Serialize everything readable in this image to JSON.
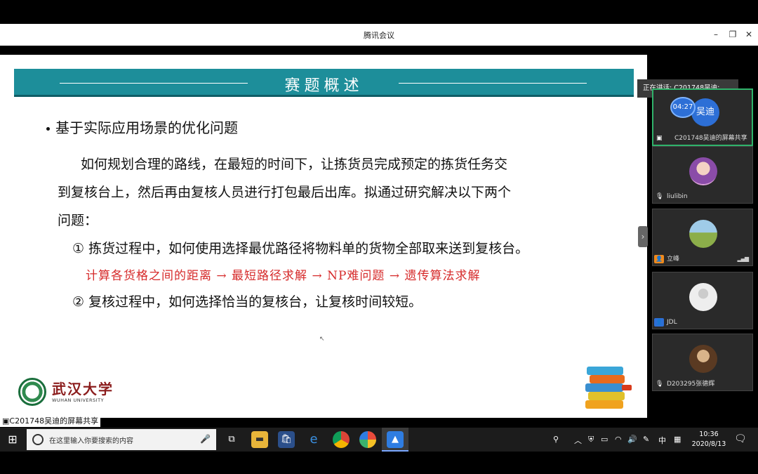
{
  "window": {
    "title": "腾讯会议",
    "minimize": "–",
    "restore": "❐",
    "close": "✕"
  },
  "slide": {
    "banner_title": "赛题概述",
    "bullet": "基于实际应用场景的优化问题",
    "para_line1": "如何规划合理的路线，在最短的时间下，让拣货员完成预定的拣货任务交",
    "para_line2": "到复核台上，然后再由复核人员进行打包最后出库。拟通过研究解决以下两个",
    "para_line3": "问题：",
    "item1": "① 拣货过程中，如何使用选择最优路径将物料单的货物全部取来送到复核台。",
    "red_flow": "计算各货格之间的距离 → 最短路径求解 → NP难问题 → 遗传算法求解",
    "item2": "② 复核过程中，如何选择恰当的复核台，让复核时间较短。",
    "logo_cn": "武汉大学",
    "logo_en": "WUHAN UNIVERSITY"
  },
  "panel": {
    "speaking": "正在讲话: C201748吴迪;",
    "timer": "04:27",
    "avatar_text": "吴迪",
    "participants": [
      {
        "name": "C201748吴迪的屏幕共享"
      },
      {
        "name": "liulibin"
      },
      {
        "name": "立峰"
      },
      {
        "name": "JDL"
      },
      {
        "name": "D203295张德辉"
      }
    ]
  },
  "share_label": "C201748吴迪的屏幕共享",
  "taskbar": {
    "search_placeholder": "在这里输入你要搜索的内容",
    "ime": "中",
    "time": "10:36",
    "date": "2020/8/13"
  }
}
